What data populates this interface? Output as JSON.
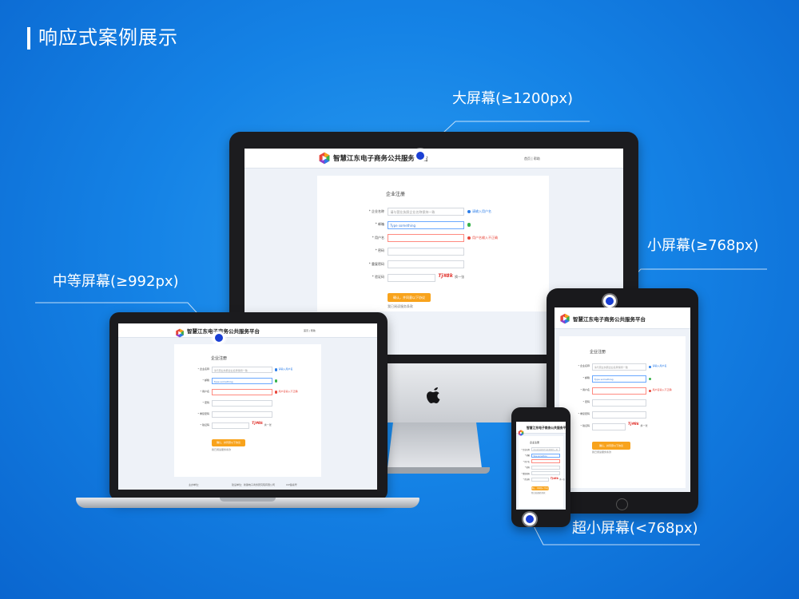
{
  "page": {
    "title": "响应式案例展示"
  },
  "callouts": {
    "large": "大屏幕(≥1200px)",
    "medium": "中等屏幕(≥992px)",
    "small": "小屏幕(≥768px)",
    "xsmall": "超小屏幕(<768px)"
  },
  "site": {
    "name": "智慧江东电子商务公共服务平台",
    "header_links": "首页 | 帮助"
  },
  "form": {
    "title": "企业注册",
    "fields": [
      {
        "label": "* 企业名称",
        "value": "请与营业执照企业名称保持一致",
        "state": "normal",
        "hint": "请输入用户名",
        "hint_state": "info"
      },
      {
        "label": "* 邮箱",
        "value": "Type something",
        "state": "focus",
        "hint": "",
        "hint_state": "ok"
      },
      {
        "label": "* 用户名",
        "value": "",
        "state": "error",
        "hint": "用户名输入不正确",
        "hint_state": "err"
      },
      {
        "label": "* 密码",
        "value": "",
        "state": "normal",
        "hint": "",
        "hint_state": "none"
      },
      {
        "label": "* 重复密码",
        "value": "",
        "state": "normal",
        "hint": "",
        "hint_state": "none"
      },
      {
        "label": "* 验证码",
        "value": "",
        "state": "normal",
        "hint": "",
        "hint_state": "none"
      }
    ],
    "captcha": "Tj#8k",
    "refresh": "换一张",
    "submit": "确认，并同意以下协议",
    "agree": "我已阅读服务条款"
  },
  "footer": {
    "col1": "主办单位：",
    "col2": "建设单位：新疆电子商务研究院有限公司",
    "col3": "ICP备案号"
  },
  "colors": {
    "accent": "#f8a31c",
    "background": "#1583e6",
    "camera": "#1a3fd4"
  }
}
